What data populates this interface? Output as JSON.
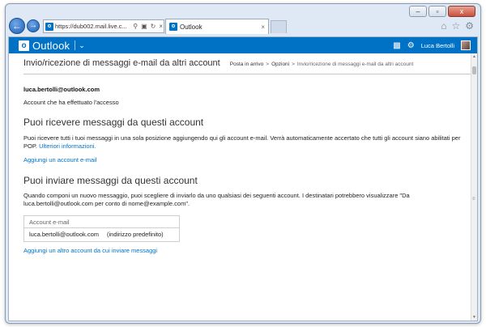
{
  "browser": {
    "url": "https://dub002.mail.live.c...",
    "tab_title": "Outlook",
    "favicon_letter": "o",
    "window_controls": [
      "–",
      "▫",
      "x"
    ],
    "toolbar_icons": [
      "home-icon",
      "star-icon",
      "gear-icon"
    ]
  },
  "app": {
    "brand": "Outlook",
    "user_name": "Luca Bertolli",
    "accent": "#0072c6"
  },
  "page": {
    "title": "Invio/ricezione di messaggi e-mail da altri account",
    "breadcrumb": {
      "home": "Posta in arrivo",
      "options": "Opzioni",
      "current": "Invio/ricezione di messaggi e-mail da altri account",
      "separator": ">"
    },
    "account_email": "luca.bertolli@outlook.com",
    "account_subtitle": "Account che ha effettuato l'accesso"
  },
  "receive": {
    "title": "Puoi ricevere messaggi da questi account",
    "description": "Puoi ricevere tutti i tuoi messaggi in una sola posizione aggiungendo qui gli account e-mail. Verrà automaticamente accertato che tutti gli account siano abilitati per POP.",
    "more_info_link": "Ulteriori informazioni.",
    "add_link": "Aggiungi un account e-mail"
  },
  "send": {
    "title": "Puoi inviare messaggi da questi account",
    "description": "Quando componi un nuovo messaggio, puoi scegliere di inviarlo da uno qualsiasi dei seguenti account. I destinatari potrebbero visualizzare \"Da luca.bertolli@outlook.com per conto di nome@example.com\".",
    "table_header": "Account e-mail",
    "rows": [
      {
        "email": "luca.bertolli@outlook.com",
        "note": "(indirizzo predefinito)"
      }
    ],
    "add_link": "Aggiungi un altro account da cui inviare messaggi"
  }
}
